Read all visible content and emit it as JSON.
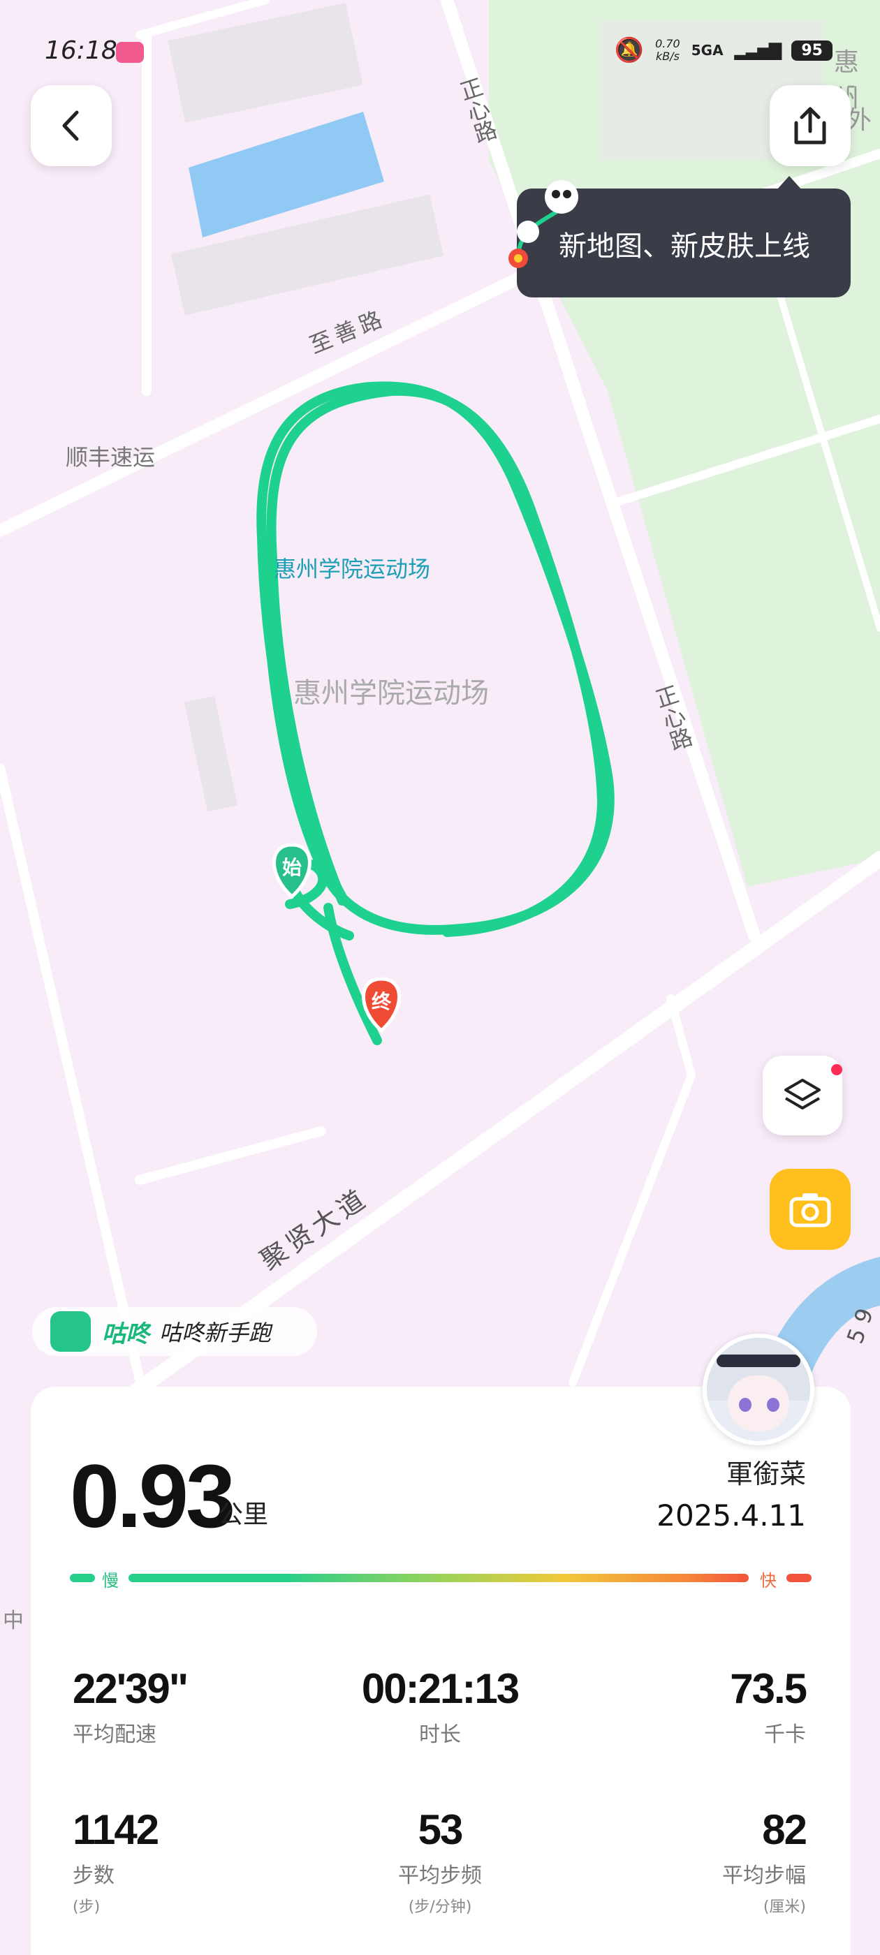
{
  "status_bar": {
    "time": "16:18",
    "net_speed": "0.70",
    "net_speed_unit": "kB/s",
    "network": "5GA",
    "battery": "95"
  },
  "map": {
    "labels": {
      "road_zhengxin_top": "正心路",
      "road_zhishan": "至善路",
      "poi_shunfeng": "顺丰速运",
      "stadium_label_blue": "惠州学院运动场",
      "stadium_label_gray": "惠州学院运动场",
      "road_zhengxin_right": "正心路",
      "road_juxian": "聚贤大道",
      "top_right_partial_1": "惠州",
      "top_right_partial_2": "-外",
      "edge_zhong": "中",
      "edge_five_nine": "5 9"
    },
    "start_marker": "始",
    "end_marker": "终",
    "route_color": "#1fd18f"
  },
  "tooltip": {
    "text": "新地图、新皮肤上线"
  },
  "brand": {
    "name": "咕咚",
    "tagline": "咕咚新手跑"
  },
  "summary": {
    "distance": "0.93",
    "distance_unit": "公里",
    "user_name": "軍銜菜",
    "date": "2025.4.11",
    "pace_scale": {
      "slow": "慢",
      "fast": "快"
    }
  },
  "stats": [
    {
      "value": "22'39\"",
      "label": "平均配速"
    },
    {
      "value": "00:21:13",
      "label": "时长"
    },
    {
      "value": "73.5",
      "label": "千卡"
    },
    {
      "value": "1142",
      "label": "步数",
      "unit": "(步)"
    },
    {
      "value": "53",
      "label": "平均步频",
      "unit": "(步/分钟)"
    },
    {
      "value": "82",
      "label": "平均步幅",
      "unit": "(厘米)"
    }
  ]
}
